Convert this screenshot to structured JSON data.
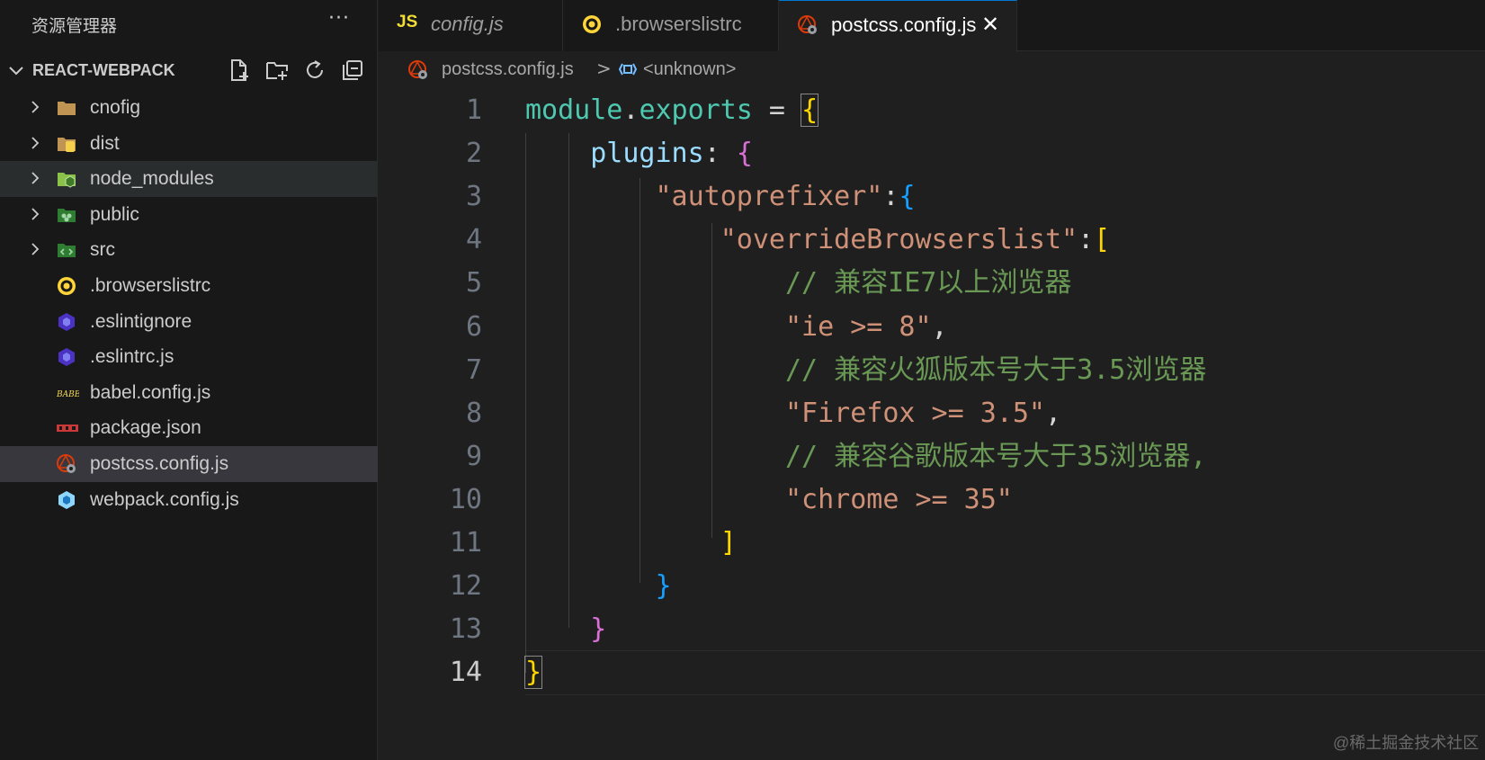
{
  "sidebar": {
    "title": "资源管理器",
    "more_label": "···",
    "project": {
      "name": "REACT-WEBPACK",
      "actions": [
        "new-file-icon",
        "new-folder-icon",
        "refresh-icon",
        "collapse-all-icon"
      ]
    },
    "items": [
      {
        "label": "cnofig",
        "type": "folder",
        "icon": "folder-icon",
        "expandable": true,
        "state": ""
      },
      {
        "label": "dist",
        "type": "folder",
        "icon": "dist-folder-icon",
        "expandable": true,
        "state": ""
      },
      {
        "label": "node_modules",
        "type": "folder",
        "icon": "node-folder-icon",
        "expandable": true,
        "state": "hover"
      },
      {
        "label": "public",
        "type": "folder",
        "icon": "public-folder-icon",
        "expandable": true,
        "state": ""
      },
      {
        "label": "src",
        "type": "folder",
        "icon": "src-folder-icon",
        "expandable": true,
        "state": ""
      },
      {
        "label": ".browserslistrc",
        "type": "file",
        "icon": "browserslist-icon",
        "expandable": false,
        "state": ""
      },
      {
        "label": ".eslintignore",
        "type": "file",
        "icon": "eslint-icon",
        "expandable": false,
        "state": ""
      },
      {
        "label": ".eslintrc.js",
        "type": "file",
        "icon": "eslint-icon",
        "expandable": false,
        "state": ""
      },
      {
        "label": "babel.config.js",
        "type": "file",
        "icon": "babel-icon",
        "expandable": false,
        "state": ""
      },
      {
        "label": "package.json",
        "type": "file",
        "icon": "npm-icon",
        "expandable": false,
        "state": ""
      },
      {
        "label": "postcss.config.js",
        "type": "file",
        "icon": "postcss-icon",
        "expandable": false,
        "state": "selected"
      },
      {
        "label": "webpack.config.js",
        "type": "file",
        "icon": "webpack-icon",
        "expandable": false,
        "state": ""
      }
    ]
  },
  "tabs": [
    {
      "label": "config.js",
      "icon": "js-icon",
      "icon_text": "JS",
      "italic": true,
      "active": false
    },
    {
      "label": ".browserslistrc",
      "icon": "browserslist-icon",
      "italic": false,
      "active": false
    },
    {
      "label": "postcss.config.js",
      "icon": "postcss-icon",
      "italic": false,
      "active": true,
      "close": "✕"
    }
  ],
  "breadcrumb": {
    "file": "postcss.config.js",
    "separator": ">",
    "symbol": "<unknown>"
  },
  "editor": {
    "current_line": 14,
    "lines": [
      {
        "n": "1",
        "tokens": [
          [
            "module",
            "#4ec9b0"
          ],
          [
            ".",
            "#d4d4d4"
          ],
          [
            "exports",
            "#4ec9b0"
          ],
          [
            " = ",
            "#d4d4d4"
          ],
          [
            "{",
            "#ffd700",
            "bm"
          ]
        ]
      },
      {
        "n": "2",
        "tokens": [
          [
            "    plugins",
            "#9cdcfe"
          ],
          [
            ": ",
            "#d4d4d4"
          ],
          [
            "{",
            "#da70d6"
          ]
        ]
      },
      {
        "n": "3",
        "tokens": [
          [
            "        ",
            "#d4d4d4"
          ],
          [
            "\"autoprefixer\"",
            "#ce9178"
          ],
          [
            ":",
            "#d4d4d4"
          ],
          [
            "{",
            "#179fff"
          ]
        ]
      },
      {
        "n": "4",
        "tokens": [
          [
            "            ",
            "#d4d4d4"
          ],
          [
            "\"overrideBrowserslist\"",
            "#ce9178"
          ],
          [
            ":",
            "#d4d4d4"
          ],
          [
            "[",
            "#ffd700"
          ]
        ]
      },
      {
        "n": "5",
        "tokens": [
          [
            "                // 兼容IE7以上浏览器",
            "#6a9955"
          ]
        ]
      },
      {
        "n": "6",
        "tokens": [
          [
            "                ",
            "#d4d4d4"
          ],
          [
            "\"ie >= 8\"",
            "#ce9178"
          ],
          [
            ",",
            "#d4d4d4"
          ]
        ]
      },
      {
        "n": "7",
        "tokens": [
          [
            "                // 兼容火狐版本号大于3.5浏览器",
            "#6a9955"
          ]
        ]
      },
      {
        "n": "8",
        "tokens": [
          [
            "                ",
            "#d4d4d4"
          ],
          [
            "\"Firefox >= 3.5\"",
            "#ce9178"
          ],
          [
            ",",
            "#d4d4d4"
          ]
        ]
      },
      {
        "n": "9",
        "tokens": [
          [
            "                // 兼容谷歌版本号大于35浏览器,",
            "#6a9955"
          ]
        ]
      },
      {
        "n": "10",
        "tokens": [
          [
            "                ",
            "#d4d4d4"
          ],
          [
            "\"chrome >= 35\"",
            "#ce9178"
          ]
        ]
      },
      {
        "n": "11",
        "tokens": [
          [
            "            ",
            "#d4d4d4"
          ],
          [
            "]",
            "#ffd700"
          ]
        ]
      },
      {
        "n": "12",
        "tokens": [
          [
            "        ",
            "#d4d4d4"
          ],
          [
            "}",
            "#179fff"
          ]
        ]
      },
      {
        "n": "13",
        "tokens": [
          [
            "    ",
            "#d4d4d4"
          ],
          [
            "}",
            "#da70d6"
          ]
        ]
      },
      {
        "n": "14",
        "tokens": [
          [
            "}",
            "#ffd700",
            "bm"
          ]
        ]
      }
    ]
  },
  "watermark": "@稀土掘金技术社区",
  "colors": {
    "bg": "#1f1f1f",
    "sidebar": "#181818",
    "selected": "#37373d",
    "accent": "#0078d4"
  }
}
